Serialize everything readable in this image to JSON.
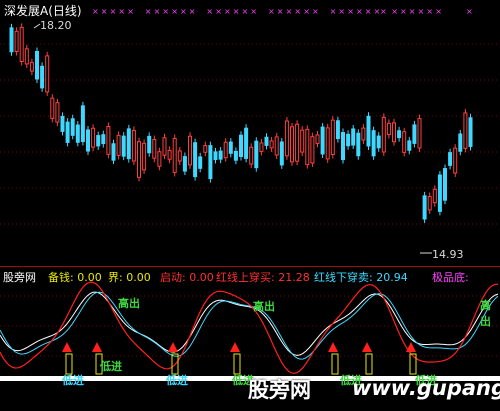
{
  "window": {
    "title": "深发展A(日线)"
  },
  "price_annotations": {
    "high": "18.20",
    "low": "14.93"
  },
  "indicator_header": {
    "source": "股旁网",
    "fields": [
      {
        "label": "备钱: ",
        "value": "0.00",
        "color": "#e8e800"
      },
      {
        "label": "界: ",
        "value": "0.00",
        "color": "#e8e800"
      },
      {
        "label": "启动: ",
        "value": "0.00",
        "color": "#ff3030"
      },
      {
        "label": "红线上穿买: ",
        "value": "21.28",
        "color": "#ff3030"
      },
      {
        "label": "红线下穿卖: ",
        "value": "20.94",
        "color": "#3fd8ff"
      },
      {
        "label": "极品底:",
        "value": "",
        "color": "#ff40ff"
      }
    ]
  },
  "signals": {
    "sell": "高出",
    "buy": "低进"
  },
  "watermark": {
    "text": "股旁网",
    "url": "www.gupang.com"
  },
  "colors": {
    "up": "#ff4040",
    "down": "#3fd8ff",
    "grid": "#7a0000",
    "line_white": "#ffffff",
    "line_cyan": "#3fd8ff",
    "line_red": "#ff2020",
    "marker_magenta": "#ff40ff"
  }
}
